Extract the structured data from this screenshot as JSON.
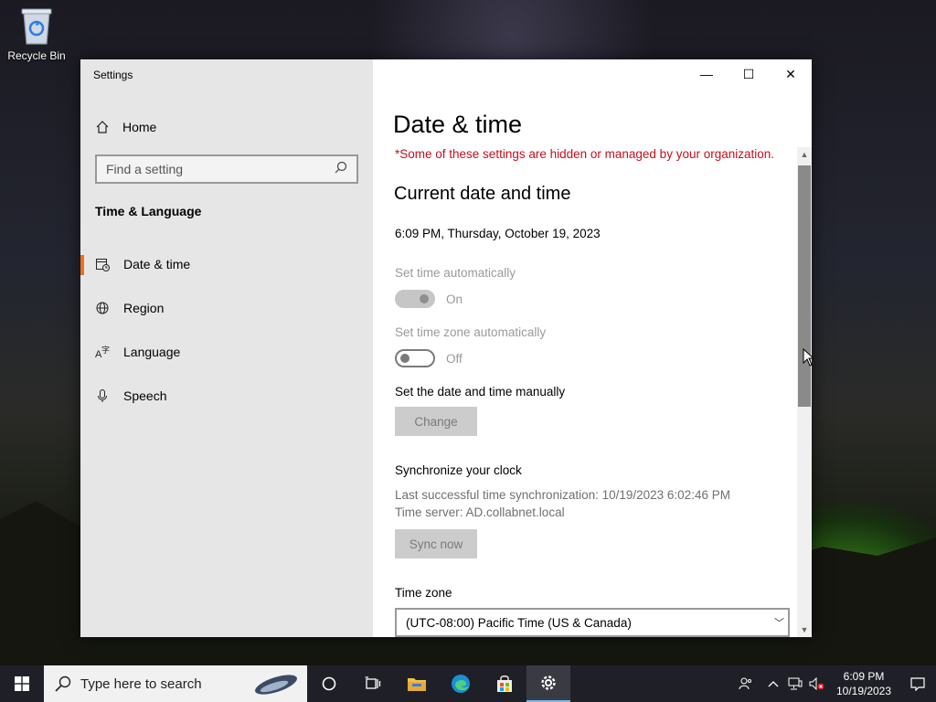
{
  "desktop": {
    "icons": [
      {
        "label": "Recycle Bin",
        "icon": "recycle-bin-icon"
      }
    ]
  },
  "window": {
    "title": "Settings",
    "controls": {
      "minimize": "—",
      "maximize": "☐",
      "close": "✕"
    }
  },
  "sidebar": {
    "home_label": "Home",
    "search_placeholder": "Find a setting",
    "section_title": "Time & Language",
    "items": [
      {
        "label": "Date & time",
        "icon": "calendar-clock-icon",
        "active": true
      },
      {
        "label": "Region",
        "icon": "globe-icon",
        "active": false
      },
      {
        "label": "Language",
        "icon": "language-icon",
        "active": false
      },
      {
        "label": "Speech",
        "icon": "microphone-icon",
        "active": false
      }
    ]
  },
  "main": {
    "title": "Date & time",
    "managed_notice": "*Some of these settings are hidden or managed by your organization.",
    "current_heading": "Current date and time",
    "current_datetime": "6:09 PM, Thursday, October 19, 2023",
    "set_time_auto": {
      "label": "Set time automatically",
      "state": "On"
    },
    "set_tz_auto": {
      "label": "Set time zone automatically",
      "state": "Off"
    },
    "manual": {
      "label": "Set the date and time manually",
      "button": "Change"
    },
    "sync": {
      "heading": "Synchronize your clock",
      "last_sync": "Last successful time synchronization: 10/19/2023 6:02:46 PM",
      "server": "Time server: AD.collabnet.local",
      "button": "Sync now"
    },
    "timezone": {
      "label": "Time zone",
      "value": "(UTC-08:00) Pacific Time (US & Canada)"
    }
  },
  "taskbar": {
    "search_placeholder": "Type here to search",
    "apps": [
      {
        "name": "cortana-icon"
      },
      {
        "name": "task-view-icon"
      },
      {
        "name": "file-explorer-icon"
      },
      {
        "name": "edge-icon"
      },
      {
        "name": "store-icon"
      },
      {
        "name": "settings-gear-icon",
        "active": true
      }
    ],
    "clock": {
      "time": "6:09 PM",
      "date": "10/19/2023"
    }
  },
  "colors": {
    "accent": "#e8731c",
    "warning": "#c50f1f",
    "taskbar": "#1f2027",
    "sidebar": "#e6e6e6"
  }
}
